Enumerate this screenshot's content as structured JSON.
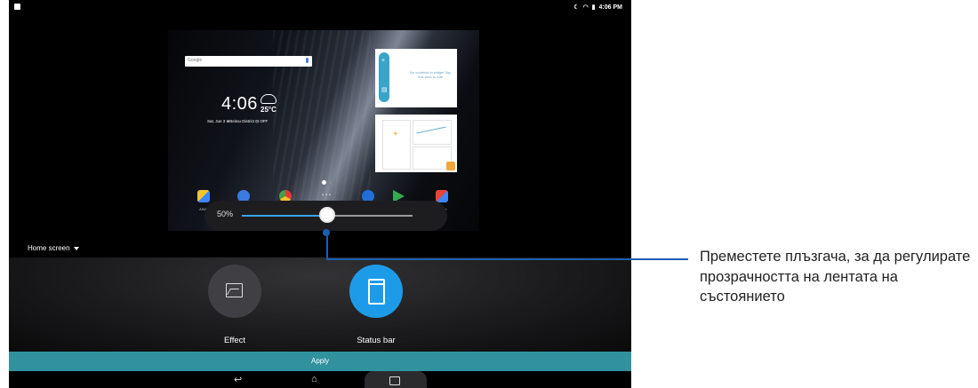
{
  "status_bar": {
    "time": "4:06 PM",
    "icons": [
      "moon-icon",
      "wifi-icon",
      "battery-icon"
    ]
  },
  "preview": {
    "search_label": "Google",
    "clock": "4:06",
    "temperature": "25°C",
    "date_line": "Sat, Jun 3 ⊕Beitou District ⊟ OFF",
    "widget_empty_text": "No contents in widget Tap this area to edit",
    "dock": [
      {
        "label": "ASUS"
      },
      {
        "label": "Messenger"
      },
      {
        "label": "Chrome"
      },
      {
        "label": ""
      },
      {
        "label": "Camera"
      },
      {
        "label": "Play Store"
      },
      {
        "label": "Google"
      }
    ]
  },
  "slider": {
    "value_label": "50%",
    "value": 0.5
  },
  "home_screen_selector": {
    "label": "Home screen"
  },
  "options": {
    "effect_label": "Effect",
    "status_bar_label": "Status bar"
  },
  "apply_label": "Apply",
  "callout": {
    "text": "Преместете плъзгача, за да регулирате прозрачността на лентата на състоянието"
  },
  "colors": {
    "accent": "#1e9be8",
    "apply_bar": "#31929e",
    "callout_line": "#1a5fb4"
  }
}
